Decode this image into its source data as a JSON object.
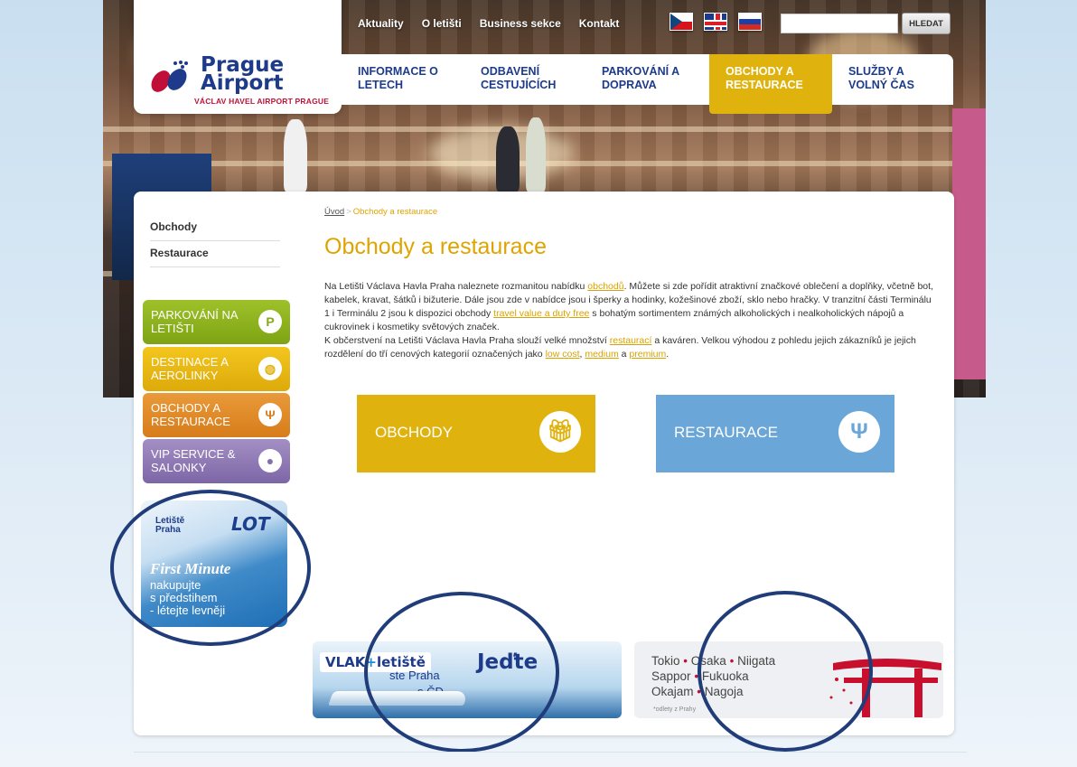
{
  "top_nav": [
    "Aktuality",
    "O letišti",
    "Business sekce",
    "Kontakt"
  ],
  "search": {
    "placeholder": "",
    "button": "HLEDAT"
  },
  "logo": {
    "line1": "Prague",
    "line2": "Airport",
    "sub": "VÁCLAV HAVEL AIRPORT PRAGUE"
  },
  "main_menu": [
    {
      "l1": "INFORMACE O",
      "l2": "LETECH"
    },
    {
      "l1": "ODBAVENÍ",
      "l2": "CESTUJÍCÍCH"
    },
    {
      "l1": "PARKOVÁNÍ A",
      "l2": "DOPRAVA"
    },
    {
      "l1": "OBCHODY A",
      "l2": "RESTAURACE"
    },
    {
      "l1": "SLUŽBY A",
      "l2": "VOLNÝ ČAS"
    }
  ],
  "sidebar": {
    "links": [
      "Obchody",
      "Restaurace"
    ]
  },
  "tiles": [
    {
      "l1": "PARKOVÁNÍ NA",
      "l2": "LETIŠTI",
      "icon": "P"
    },
    {
      "l1": "DESTINACE A",
      "l2": "AEROLINKY",
      "icon": "◍"
    },
    {
      "l1": "OBCHODY A",
      "l2": "RESTAURACE",
      "icon": "Ψ"
    },
    {
      "l1": "VIP SERVICE &",
      "l2": "SALONKY",
      "icon": "●"
    }
  ],
  "lot_banner": {
    "airport": "Letiště",
    "airport2": "Praha",
    "airline": "LOT",
    "headline": "First Minute",
    "line1": "nakupujte",
    "line2": "s předstihem",
    "line3": "- létejte levněji"
  },
  "breadcrumb": {
    "home": "Úvod",
    "separator": ">",
    "current": "Obchody a restaurace"
  },
  "page_title": "Obchody a restaurace",
  "intro": {
    "p1a": "Na Letišti Václava Havla Praha naleznete rozmanitou nabídku ",
    "p1link": "obchodů",
    "p1b": ". Můžete si zde pořídit atraktivní značkové oblečení a doplňky, včetně bot, kabelek, kravat, šátků i bižuterie. Dále jsou zde v nabídce jsou i šperky a hodinky, kožešinové zboží, sklo nebo hračky. V tranzitní části Terminálu 1 i Terminálu 2 jsou k dispozici obchody ",
    "p1link2": "travel value a duty free",
    "p1c": " s bohatým sortimentem známých alkoholických i nealkoholických nápojů a cukrovinek i kosmetiky světových značek.",
    "p2a": "K občerstvení na Letišti Václava Havla Praha slouží velké množství ",
    "p2link": "restaurací",
    "p2b": " a kaváren. Velkou výhodou z pohledu jejich zákazníků je jejich rozdělení  do tří cenových kategorií označených jako ",
    "p2link2": "low cost",
    "p2c": ", ",
    "p2link3": "medium",
    "p2d": " a ",
    "p2link4": "premium",
    "p2e": "."
  },
  "buttons": {
    "shops": "OBCHODY",
    "restaurants": "RESTAURACE"
  },
  "vlak_banner": {
    "brand1": "VLAK",
    "plus": "+",
    "brand2": "letiště",
    "headline": "Jeďte",
    "text1": "ste Praha",
    "text2": "s ČD"
  },
  "japan_banner": {
    "r1a": "Tokio",
    "r1b": "Osaka",
    "r1c": "Niigata",
    "r2a": "Sappor",
    "r2b": "Fukuoka",
    "r3a": "Okajam",
    "r3b": "Nagoja",
    "sep": "•",
    "footnote": "*odlety z Prahy"
  },
  "colors": {
    "accent": "#e0b20d",
    "brand_blue": "#1d3b8a",
    "restaurant_blue": "#6aa6d8"
  }
}
